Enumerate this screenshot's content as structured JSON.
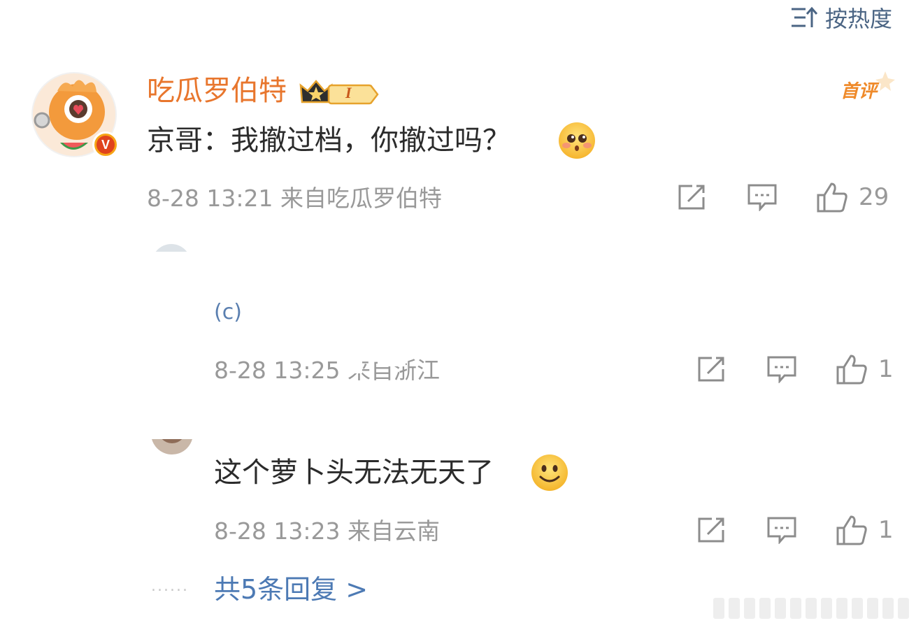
{
  "sort": {
    "label": "按热度"
  },
  "main_comment": {
    "author": "吃瓜罗伯特",
    "level_badge": "I",
    "first_badge": "首评",
    "verified_badge": "V",
    "text": "京哥：我撤过档，你撤过吗？",
    "emoji": "shy-emoji",
    "meta": "8-28 13:21 来自吃瓜罗伯特",
    "likes": "29"
  },
  "replies": [
    {
      "text": "(c)",
      "meta": "8-28 13:25 来自浙江",
      "likes": "1"
    },
    {
      "text": "这个萝卜头无法无天了",
      "emoji": "smile-emoji",
      "meta": "8-28 13:23 来自云南",
      "likes": "1"
    }
  ],
  "total_replies": {
    "dots": "......",
    "label": "共5条回复 >"
  },
  "colors": {
    "author": "#e8762d",
    "link": "#4d7ab4",
    "meta": "#999999",
    "sort": "#4b6584"
  }
}
